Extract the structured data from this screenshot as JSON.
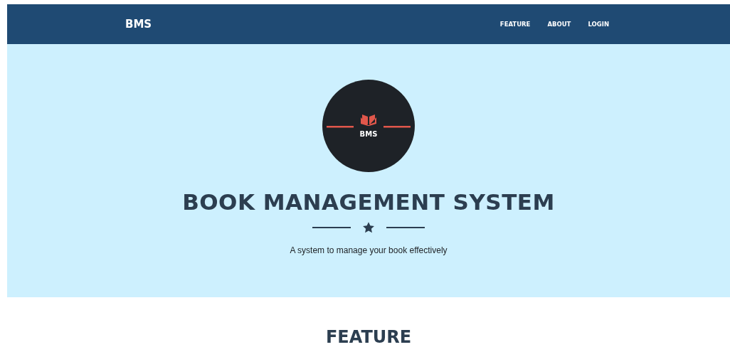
{
  "navbar": {
    "brand": "BMS",
    "links": [
      "FEATURE",
      "ABOUT",
      "LOGIN"
    ]
  },
  "hero": {
    "logo_text": "BMS",
    "title": "BOOK MANAGEMENT SYSTEM",
    "subtitle": "A system to manage your book effectively"
  },
  "feature_section": {
    "heading": "FEATURE"
  }
}
